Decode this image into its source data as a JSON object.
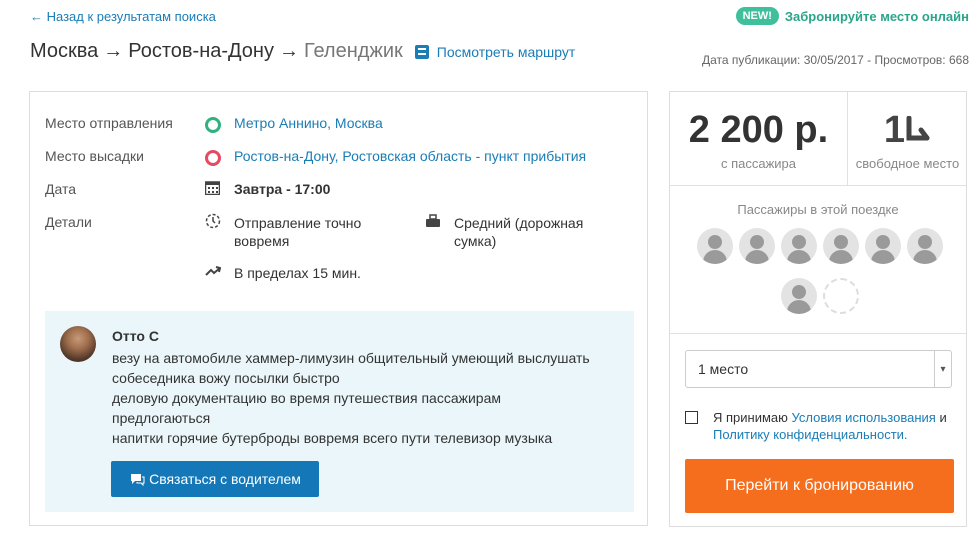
{
  "nav": {
    "back_label": "← Назад к результатам поиска",
    "new_badge": "NEW!",
    "book_online": "Забронируйте место онлайн"
  },
  "route": {
    "from": "Москва",
    "mid": "Ростов-на-Дону",
    "to": "Геленджик",
    "arrow": "→",
    "view_route_label": "Посмотреть маршрут"
  },
  "publication": "Дата публикации: 30/05/2017 - Просмотров: 668",
  "details": {
    "departure_label": "Место отправления",
    "departure_value": "Метро Аннино, Москва",
    "dropoff_label": "Место высадки",
    "dropoff_value": "Ростов-на-Дону, Ростовская область - пункт прибытия",
    "date_label": "Дата",
    "date_value": "Завтра - 17:00",
    "details_label": "Детали",
    "punctuality": "Отправление точно вовремя",
    "luggage": "Средний (дорожная сумка)",
    "detour": "В пределах 15 мин."
  },
  "driver": {
    "name": "Отто С",
    "description_lines": [
      "везу на автомобиле хаммер-лимузин общительный умеющий выслушать",
      "собеседника вожу посылки быстро",
      "деловую документацию во время путешествия пассажирам",
      "предлогаються",
      "напитки горячие бутерброды вовремя всего пути телевизор музыка"
    ],
    "contact_label": "Связаться с водителем"
  },
  "booking": {
    "price": "2 200 р.",
    "price_sub": "с пассажира",
    "seats": "1",
    "seats_sub": "свободное место",
    "passengers_title": "Пассажиры в этой поездке",
    "seat_select": "1 место",
    "terms_prefix": "Я принимаю",
    "terms_link": "Условия использования",
    "terms_and": "и",
    "privacy_link": "Политику конфиденциальности.",
    "book_button": "Перейти к бронированию"
  },
  "colors": {
    "link": "#1a7db6",
    "book_button": "#f46e1e",
    "contact_button": "#1478b8",
    "new_badge": "#3fbf9c"
  }
}
